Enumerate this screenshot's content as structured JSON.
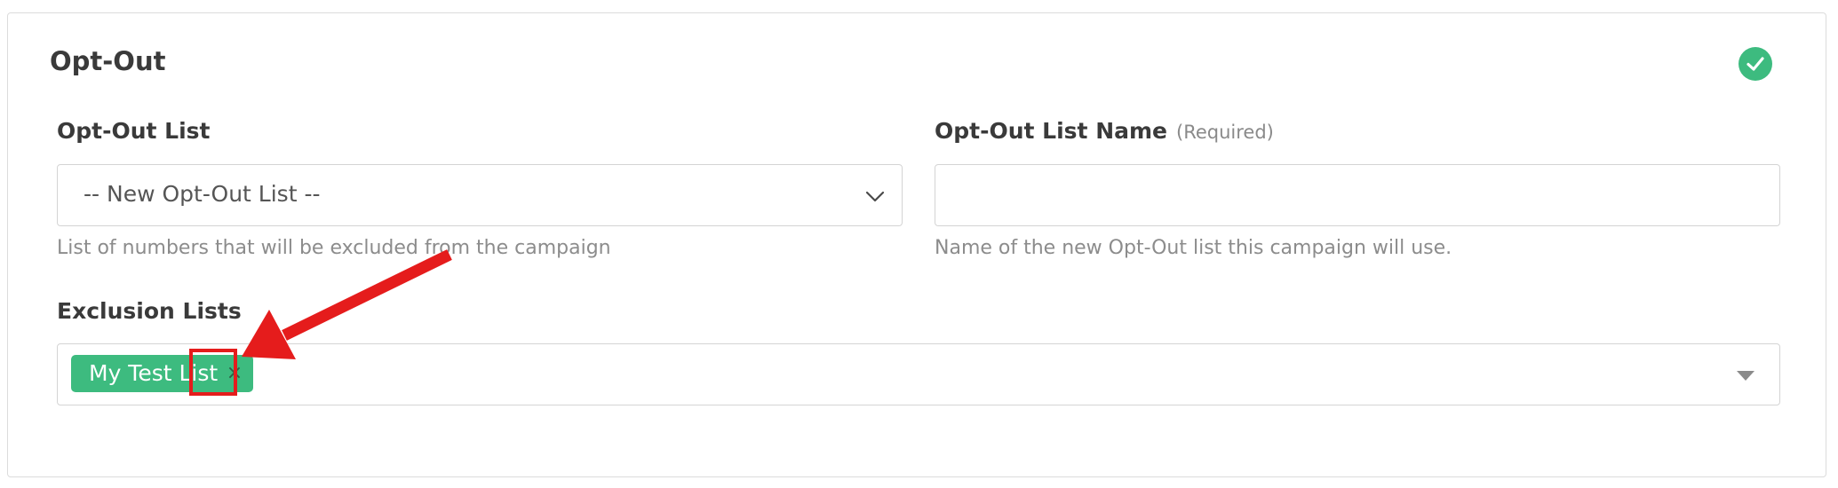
{
  "section": {
    "title": "Opt-Out",
    "status_icon": "check-circle-icon",
    "status_color": "#3dbb7f"
  },
  "opt_out_list": {
    "label": "Opt-Out List",
    "selected": "-- New Opt-Out List --",
    "help": "List of numbers that will be excluded from the campaign"
  },
  "opt_out_list_name": {
    "label": "Opt-Out List Name",
    "required_note": "(Required)",
    "value": "",
    "placeholder": "",
    "help": "Name of the new Opt-Out list this campaign will use."
  },
  "exclusion_lists": {
    "label": "Exclusion Lists",
    "tags": [
      {
        "label": "My Test List",
        "remove_symbol": "×"
      }
    ]
  },
  "annotation": {
    "color": "#e51c1c",
    "target": "tag-remove-button"
  }
}
